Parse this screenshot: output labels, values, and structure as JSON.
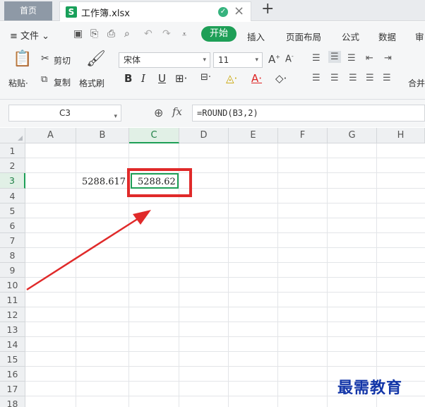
{
  "tabs": {
    "home": "首页",
    "doc_icon": "S",
    "doc_name": "工作簿.xlsx",
    "new_tab": "+"
  },
  "menu": {
    "file_label": "文件",
    "items": [
      "开始",
      "插入",
      "页面布局",
      "公式",
      "数据",
      "审"
    ]
  },
  "ribbon": {
    "paste": "粘贴",
    "cut": "剪切",
    "copy": "复制",
    "format_painter": "格式刷",
    "font_name": "宋体",
    "font_size": "11",
    "bold": "B",
    "italic": "I",
    "underline": "U",
    "merge": "合并"
  },
  "formula_bar": {
    "name_box": "C3",
    "fx": "fx",
    "formula": "=ROUND(B3,2)"
  },
  "grid": {
    "columns": [
      "A",
      "B",
      "C",
      "D",
      "E",
      "F",
      "G",
      "H"
    ],
    "active_column": "C",
    "rows": [
      "1",
      "2",
      "3",
      "4",
      "5",
      "6",
      "7",
      "8",
      "9",
      "10",
      "11",
      "12",
      "13",
      "14",
      "15",
      "16",
      "17",
      "18"
    ],
    "active_row": "3",
    "cells": {
      "B3": "5288.617",
      "C3": "5288.62"
    }
  },
  "watermark": "最需教育",
  "colors": {
    "accent": "#1e9f57",
    "highlight": "#e02a2a",
    "watermark": "#1336a8"
  }
}
